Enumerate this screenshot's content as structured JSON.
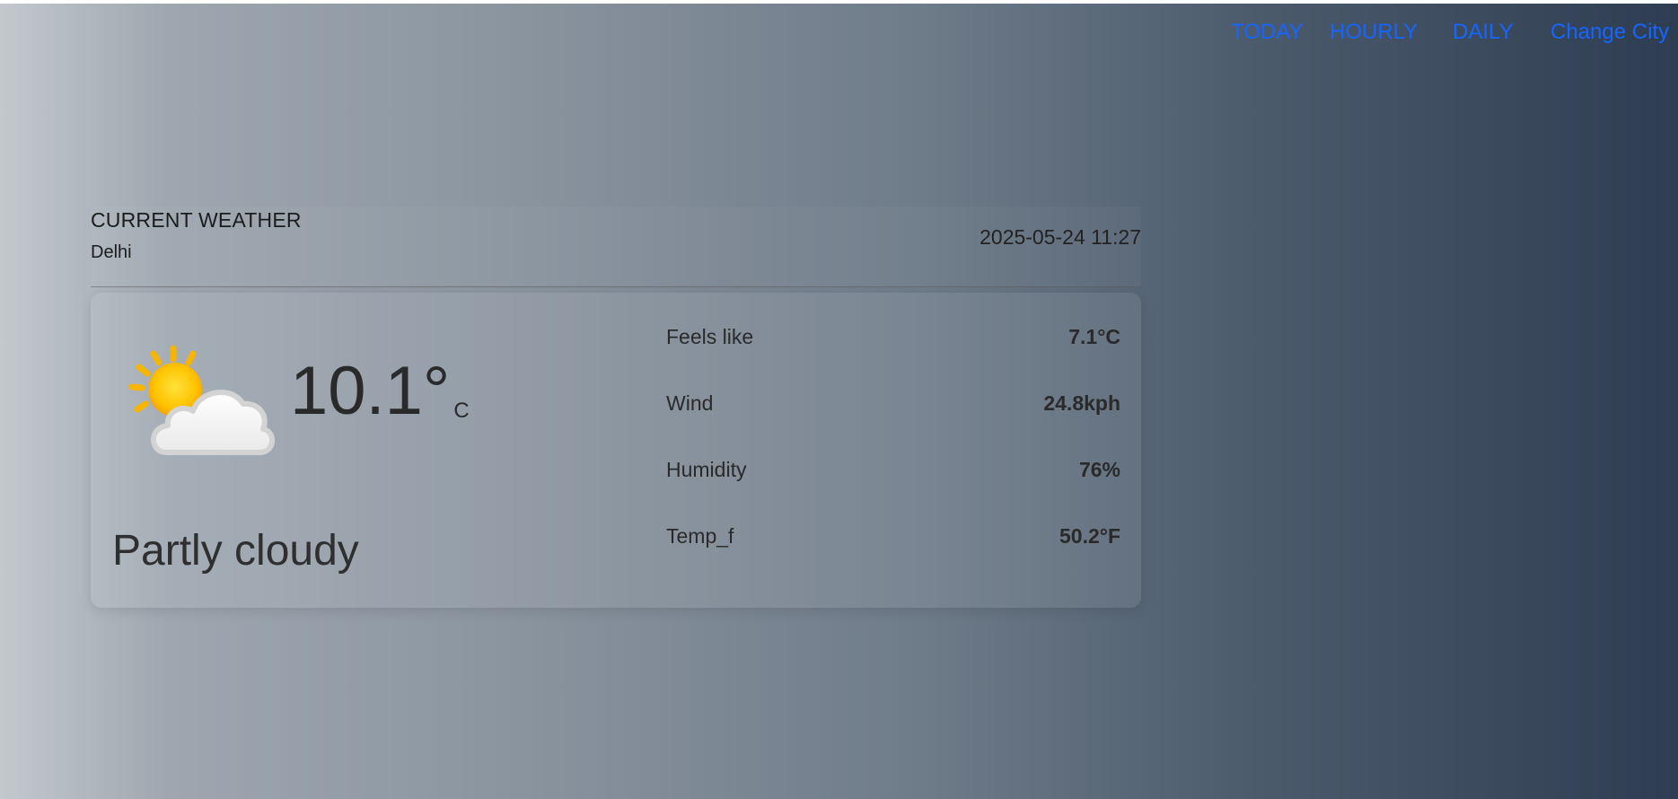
{
  "nav": {
    "items": [
      {
        "label": "TODAY"
      },
      {
        "label": "HOURLY"
      },
      {
        "label": "DAILY"
      },
      {
        "label": "Change City"
      }
    ]
  },
  "current": {
    "title": "CURRENT WEATHER",
    "city": "Delhi",
    "datetime": "2025-05-24 11:27",
    "temperature": "10.1°",
    "temperature_unit": "C",
    "condition": "Partly cloudy",
    "icon": "partly-cloudy-icon",
    "stats": [
      {
        "label": "Feels like",
        "value": "7.1°C"
      },
      {
        "label": "Wind",
        "value": "24.8kph"
      },
      {
        "label": "Humidity",
        "value": "76%"
      },
      {
        "label": "Temp_f",
        "value": "50.2°F"
      }
    ]
  },
  "colors": {
    "link": "#1565ff",
    "text": "#2a2a2a",
    "gradient_start": "#c3c8cd",
    "gradient_end": "#2e3d51"
  }
}
